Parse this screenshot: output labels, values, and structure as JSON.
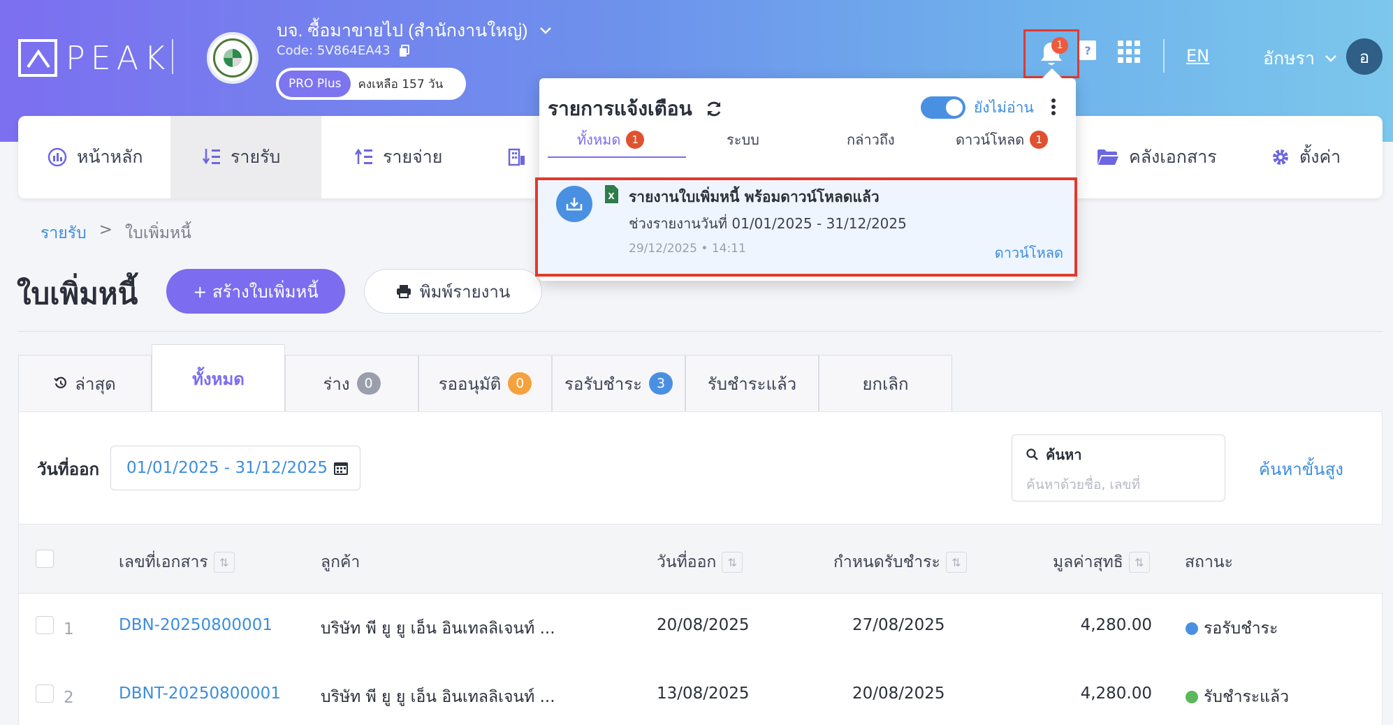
{
  "header": {
    "logo_text": "PEAK",
    "company_name": "บจ. ซื้อมาขายไป (สำนักงานใหญ่)",
    "company_code": "Code: 5V864EA43",
    "plan_label": "PRO Plus",
    "plan_remaining": "คงเหลือ 157 วัน",
    "notification_count": "1",
    "language": "EN",
    "user_name": "อักษรา",
    "user_initial": "อ",
    "colors": {
      "gradient_start": "#7c6ff0",
      "gradient_end": "#7cc7ec",
      "badge": "#ef5a3c"
    }
  },
  "nav": {
    "items": [
      {
        "label": "หน้าหลัก",
        "icon": "chart-icon"
      },
      {
        "label": "รายรับ",
        "icon": "income-icon",
        "active": true
      },
      {
        "label": "รายจ่าย",
        "icon": "expense-icon"
      },
      {
        "label": "",
        "icon": "building-icon"
      },
      {
        "label": "คลังเอกสาร",
        "icon": "folder-icon"
      },
      {
        "label": "ตั้งค่า",
        "icon": "gear-icon"
      }
    ]
  },
  "breadcrumb": {
    "parent": "รายรับ",
    "separator": ">",
    "current": "ใบเพิ่มหนี้"
  },
  "page": {
    "title": "ใบเพิ่มหนี้",
    "create_button": "+ สร้างใบเพิ่มหนี้",
    "print_button": "พิมพ์รายงาน"
  },
  "tabs": [
    {
      "label": "ล่าสุด",
      "icon": "history-icon"
    },
    {
      "label": "ทั้งหมด",
      "active": true
    },
    {
      "label": "ร่าง",
      "count": "0",
      "color": "#9aa0ab"
    },
    {
      "label": "รออนุมัติ",
      "count": "0",
      "color": "#f5a13c"
    },
    {
      "label": "รอรับชำระ",
      "count": "3",
      "color": "#4a90e2"
    },
    {
      "label": "รับชำระแล้ว"
    },
    {
      "label": "ยกเลิก"
    }
  ],
  "filters": {
    "date_label": "วันที่ออก",
    "date_range": "01/01/2025 - 31/12/2025",
    "search_label": "ค้นหา",
    "search_placeholder": "ค้นหาด้วยชื่อ, เลขที่",
    "advanced_search": "ค้นหาขั้นสูง"
  },
  "table": {
    "columns": [
      "เลขที่เอกสาร",
      "ลูกค้า",
      "วันที่ออก",
      "กำหนดรับชำระ",
      "มูลค่าสุทธิ",
      "สถานะ"
    ],
    "rows": [
      {
        "index": "1",
        "doc_no": "DBN-20250800001",
        "customer": "บริษัท พี ยู ยู เอ็น อินเทลลิเจนท์ ...",
        "issue_date": "20/08/2025",
        "due_date": "27/08/2025",
        "amount": "4,280.00",
        "status": "รอรับชำระ",
        "status_color": "#4a90e2"
      },
      {
        "index": "2",
        "doc_no": "DBNT-20250800001",
        "customer": "บริษัท พี ยู ยู เอ็น อินเทลลิเจนท์ ...",
        "issue_date": "13/08/2025",
        "due_date": "20/08/2025",
        "amount": "4,280.00",
        "status": "รับชำระแล้ว",
        "status_color": "#5cb85c"
      }
    ]
  },
  "notifications": {
    "title": "รายการแจ้งเตือน",
    "unread_toggle_label": "ยังไม่อ่าน",
    "unread_toggle_on": true,
    "tabs": [
      {
        "label": "ทั้งหมด",
        "count": "1",
        "active": true
      },
      {
        "label": "ระบบ"
      },
      {
        "label": "กล่าวถึง"
      },
      {
        "label": "ดาวน์โหลด",
        "count": "1"
      }
    ],
    "items": [
      {
        "title": "รายงานใบเพิ่มหนี้ พร้อมดาวน์โหลดแล้ว",
        "detail": "ช่วงรายงานวันที่ 01/01/2025 - 31/12/2025",
        "timestamp": "29/12/2025 • 14:11",
        "action": "ดาวน์โหลด"
      }
    ]
  }
}
